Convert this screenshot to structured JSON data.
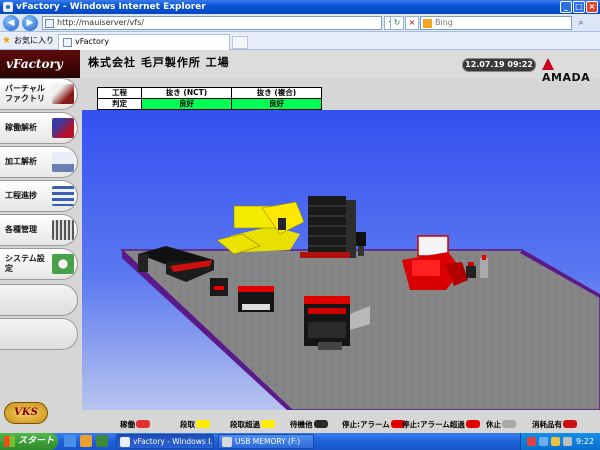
{
  "window": {
    "title": "vFactory - Windows Internet Explorer"
  },
  "browser": {
    "address": "http://mauiserver/vfs/",
    "search_placeholder": "Bing",
    "favorites_label": "お気に入り",
    "tab_label": "vFactory"
  },
  "app": {
    "logo": "vFactory",
    "company": "株式会社 毛戸製作所 工場",
    "datetime": "12.07.19 09:22",
    "brand": "AMADA",
    "vks_logo": "VKS"
  },
  "sidebar": {
    "items": [
      {
        "label": "バーチャル ファクトリ",
        "thumb_color": "#8a1a1a"
      },
      {
        "label": "稼働解析",
        "thumb_color": "#b5122a"
      },
      {
        "label": "加工解析",
        "thumb_color": "#6a7fb0"
      },
      {
        "label": "工程進捗",
        "thumb_color": "#3a5fb0"
      },
      {
        "label": "各種管理",
        "thumb_color": "#555555"
      },
      {
        "label": "システム設定",
        "thumb_color": "#4aa04a"
      }
    ]
  },
  "status_table": {
    "headers": [
      "工程",
      "抜き (NCT)",
      "抜き (複合)"
    ],
    "row_label": "判定",
    "values": [
      "良好",
      "良好"
    ],
    "ok_color": "#00ff55"
  },
  "legend": [
    {
      "label": "稼働",
      "color": "#e03030"
    },
    {
      "label": "段取",
      "color": "#ffee00"
    },
    {
      "label": "段取超過",
      "color": "#ffee00"
    },
    {
      "label": "待機他",
      "color": "#2a2a2a"
    },
    {
      "label": "停止:アラーム",
      "color": "#e00000"
    },
    {
      "label": "停止:アラーム超過",
      "color": "#e00000"
    },
    {
      "label": "休止",
      "color": "#a8a8a8"
    },
    {
      "label": "消耗品有",
      "color": "#cc1010"
    }
  ],
  "taskbar": {
    "start_label": "スタート",
    "tasks": [
      "vFactory - Windows I...",
      "USB MEMORY (F:)"
    ],
    "clock": "9:22"
  },
  "colors": {
    "titlebar": "#0a55d8",
    "sky": "#3c5ff0",
    "floor": "#808080",
    "floor_edge": "#5a1a8a"
  }
}
